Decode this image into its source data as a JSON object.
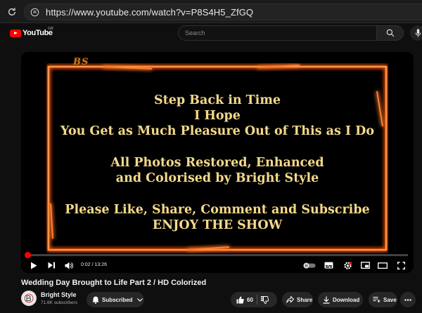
{
  "browser": {
    "url": "https://www.youtube.com/watch?v=P8S4H5_ZfGQ"
  },
  "header": {
    "logo_text": "YouTube",
    "region": "GB",
    "search_placeholder": "Search"
  },
  "video": {
    "watermark": "BS",
    "lines": [
      "Step Back in Time",
      "I  Hope",
      "You Get as Much Pleasure Out of  This as I  Do",
      "All Photos Restored, Enhanced",
      "and Colorised by Bright Style",
      "Please Like, Share, Comment and Subscribe",
      "ENJOY  THE  SHOW"
    ],
    "time": "0:02 / 13:26",
    "progress_fraction": 0.0025
  },
  "title": "Wedding Day Brought to Life Part 2 / HD Colorized",
  "channel": {
    "name": "Bright Style",
    "subscribers": "71.6K subscribers"
  },
  "actions": {
    "subscribed_label": "Subscribed",
    "likes": "60",
    "share_label": "Share",
    "download_label": "Download",
    "save_label": "Save"
  },
  "colors": {
    "accent": "#ff0000",
    "frame_fire": "#ff6a1a",
    "text_gold": "#f4d98a"
  }
}
